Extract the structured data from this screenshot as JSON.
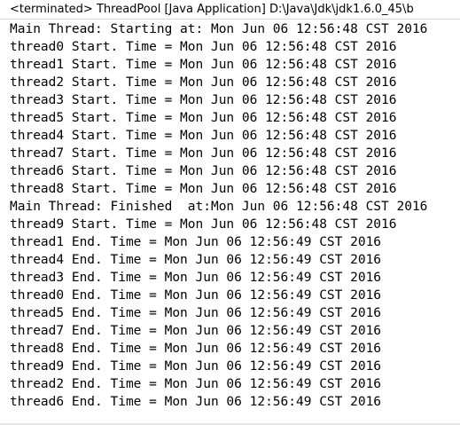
{
  "console": {
    "header": "<terminated> ThreadPool [Java Application] D:\\Java\\Jdk\\jdk1.6.0_45\\b",
    "lines": [
      "Main Thread: Starting at: Mon Jun 06 12:56:48 CST 2016",
      "thread0 Start. Time = Mon Jun 06 12:56:48 CST 2016",
      "thread1 Start. Time = Mon Jun 06 12:56:48 CST 2016",
      "thread2 Start. Time = Mon Jun 06 12:56:48 CST 2016",
      "thread3 Start. Time = Mon Jun 06 12:56:48 CST 2016",
      "thread5 Start. Time = Mon Jun 06 12:56:48 CST 2016",
      "thread4 Start. Time = Mon Jun 06 12:56:48 CST 2016",
      "thread7 Start. Time = Mon Jun 06 12:56:48 CST 2016",
      "thread6 Start. Time = Mon Jun 06 12:56:48 CST 2016",
      "thread8 Start. Time = Mon Jun 06 12:56:48 CST 2016",
      "Main Thread: Finished  at:Mon Jun 06 12:56:48 CST 2016",
      "thread9 Start. Time = Mon Jun 06 12:56:48 CST 2016",
      "thread1 End. Time = Mon Jun 06 12:56:49 CST 2016",
      "thread4 End. Time = Mon Jun 06 12:56:49 CST 2016",
      "thread3 End. Time = Mon Jun 06 12:56:49 CST 2016",
      "thread0 End. Time = Mon Jun 06 12:56:49 CST 2016",
      "thread5 End. Time = Mon Jun 06 12:56:49 CST 2016",
      "thread7 End. Time = Mon Jun 06 12:56:49 CST 2016",
      "thread8 End. Time = Mon Jun 06 12:56:49 CST 2016",
      "thread9 End. Time = Mon Jun 06 12:56:49 CST 2016",
      "thread2 End. Time = Mon Jun 06 12:56:49 CST 2016",
      "thread6 End. Time = Mon Jun 06 12:56:49 CST 2016"
    ]
  }
}
